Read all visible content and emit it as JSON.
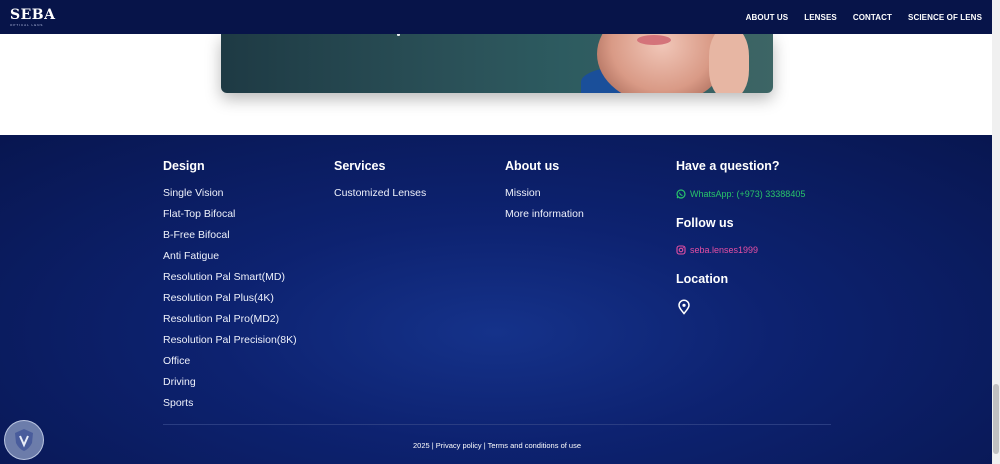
{
  "brand": {
    "logo": "SEBA",
    "logo_sub": "OPTICAL LENS"
  },
  "nav": {
    "items": [
      "ABOUT US",
      "LENSES",
      "CONTACT",
      "SCIENCE OF LENS"
    ]
  },
  "footer": {
    "design": {
      "heading": "Design",
      "items": [
        "Single Vision",
        "Flat-Top Bifocal",
        "B-Free Bifocal",
        "Anti Fatigue",
        "Resolution Pal Smart(MD)",
        "Resolution Pal Plus(4K)",
        "Resolution Pal Pro(MD2)",
        "Resolution Pal Precision(8K)",
        "Office",
        "Driving",
        "Sports"
      ]
    },
    "services": {
      "heading": "Services",
      "items": [
        "Customized Lenses"
      ]
    },
    "about": {
      "heading": "About us",
      "items": [
        "Mission",
        "More information"
      ]
    },
    "contact": {
      "question_heading": "Have a question?",
      "whatsapp": "WhatsApp: (+973) 33388405",
      "follow_heading": "Follow us",
      "instagram": "seba.lenses1999",
      "location_heading": "Location"
    },
    "copyright": "2025 | Privacy policy | Terms and conditions of use"
  },
  "colors": {
    "nav_bg": "#071449",
    "footer_bg": "#0d2270",
    "whatsapp": "#29c46a",
    "instagram": "#e64fa3"
  },
  "icons": {
    "whatsapp": "whatsapp-icon",
    "instagram": "instagram-icon",
    "location": "location-pin-icon"
  }
}
